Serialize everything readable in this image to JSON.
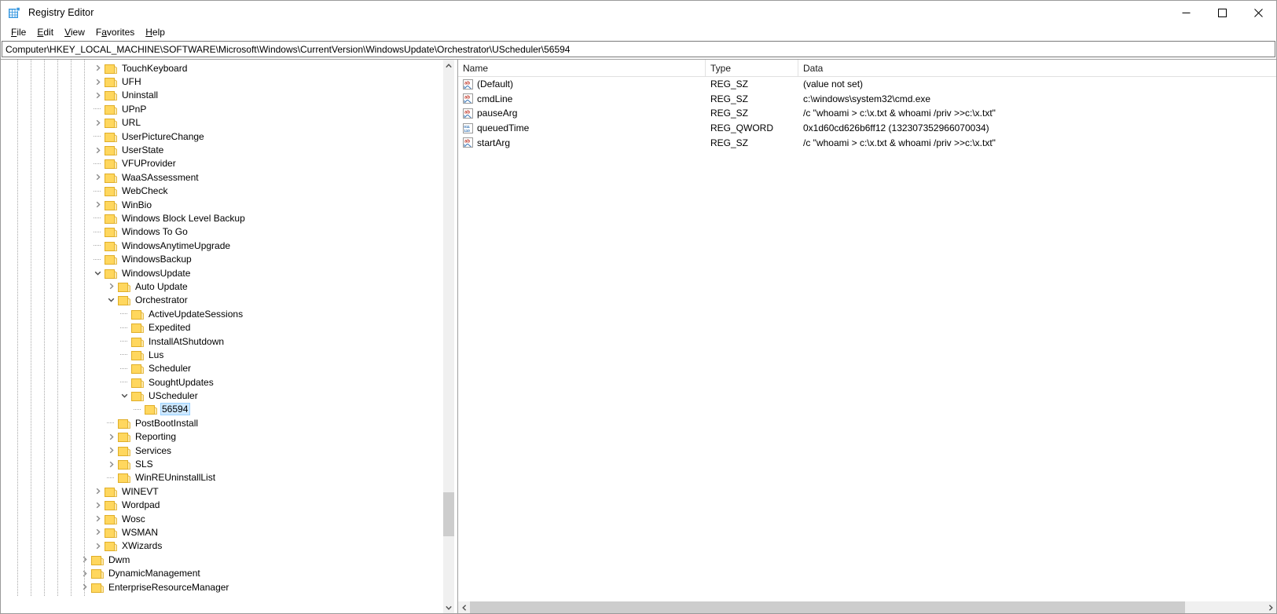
{
  "window": {
    "title": "Registry Editor",
    "icon": "registry-editor-icon",
    "minimize_label": "—",
    "maximize_label": "□",
    "close_label": "×"
  },
  "menubar": {
    "items": [
      {
        "label": "File",
        "accesskey": "F"
      },
      {
        "label": "Edit",
        "accesskey": "E"
      },
      {
        "label": "View",
        "accesskey": "V"
      },
      {
        "label": "Favorites",
        "accesskey": "a"
      },
      {
        "label": "Help",
        "accesskey": "H"
      }
    ]
  },
  "address": {
    "value": "Computer\\HKEY_LOCAL_MACHINE\\SOFTWARE\\Microsoft\\Windows\\CurrentVersion\\WindowsUpdate\\Orchestrator\\UScheduler\\56594",
    "placeholder": "Computer\\"
  },
  "tree": {
    "nodes": [
      {
        "label": "TouchKeyboard",
        "depth": 6,
        "state": "collapsed"
      },
      {
        "label": "UFH",
        "depth": 6,
        "state": "collapsed"
      },
      {
        "label": "Uninstall",
        "depth": 6,
        "state": "collapsed"
      },
      {
        "label": "UPnP",
        "depth": 6,
        "state": "leaf"
      },
      {
        "label": "URL",
        "depth": 6,
        "state": "collapsed"
      },
      {
        "label": "UserPictureChange",
        "depth": 6,
        "state": "leaf"
      },
      {
        "label": "UserState",
        "depth": 6,
        "state": "collapsed"
      },
      {
        "label": "VFUProvider",
        "depth": 6,
        "state": "leaf"
      },
      {
        "label": "WaaSAssessment",
        "depth": 6,
        "state": "collapsed"
      },
      {
        "label": "WebCheck",
        "depth": 6,
        "state": "leaf"
      },
      {
        "label": "WinBio",
        "depth": 6,
        "state": "collapsed"
      },
      {
        "label": "Windows Block Level Backup",
        "depth": 6,
        "state": "leaf"
      },
      {
        "label": "Windows To Go",
        "depth": 6,
        "state": "leaf"
      },
      {
        "label": "WindowsAnytimeUpgrade",
        "depth": 6,
        "state": "leaf"
      },
      {
        "label": "WindowsBackup",
        "depth": 6,
        "state": "leaf"
      },
      {
        "label": "WindowsUpdate",
        "depth": 6,
        "state": "expanded"
      },
      {
        "label": "Auto Update",
        "depth": 7,
        "state": "collapsed"
      },
      {
        "label": "Orchestrator",
        "depth": 7,
        "state": "expanded"
      },
      {
        "label": "ActiveUpdateSessions",
        "depth": 8,
        "state": "leaf"
      },
      {
        "label": "Expedited",
        "depth": 8,
        "state": "leaf"
      },
      {
        "label": "InstallAtShutdown",
        "depth": 8,
        "state": "leaf"
      },
      {
        "label": "Lus",
        "depth": 8,
        "state": "leaf"
      },
      {
        "label": "Scheduler",
        "depth": 8,
        "state": "leaf"
      },
      {
        "label": "SoughtUpdates",
        "depth": 8,
        "state": "leaf"
      },
      {
        "label": "UScheduler",
        "depth": 8,
        "state": "expanded"
      },
      {
        "label": "56594",
        "depth": 9,
        "state": "leaf",
        "selected": true
      },
      {
        "label": "PostBootInstall",
        "depth": 7,
        "state": "leaf"
      },
      {
        "label": "Reporting",
        "depth": 7,
        "state": "collapsed"
      },
      {
        "label": "Services",
        "depth": 7,
        "state": "collapsed"
      },
      {
        "label": "SLS",
        "depth": 7,
        "state": "collapsed"
      },
      {
        "label": "WinREUninstallList",
        "depth": 7,
        "state": "leaf"
      },
      {
        "label": "WINEVT",
        "depth": 6,
        "state": "collapsed"
      },
      {
        "label": "Wordpad",
        "depth": 6,
        "state": "collapsed"
      },
      {
        "label": "Wosc",
        "depth": 6,
        "state": "collapsed"
      },
      {
        "label": "WSMAN",
        "depth": 6,
        "state": "collapsed"
      },
      {
        "label": "XWizards",
        "depth": 6,
        "state": "collapsed"
      },
      {
        "label": "Dwm",
        "depth": 5,
        "state": "collapsed"
      },
      {
        "label": "DynamicManagement",
        "depth": 5,
        "state": "collapsed"
      },
      {
        "label": "EnterpriseResourceManager",
        "depth": 5,
        "state": "collapsed"
      }
    ]
  },
  "values": {
    "columns": [
      "Name",
      "Type",
      "Data"
    ],
    "rows": [
      {
        "icon": "string-value-icon",
        "name": "(Default)",
        "type": "REG_SZ",
        "data": "(value not set)"
      },
      {
        "icon": "string-value-icon",
        "name": "cmdLine",
        "type": "REG_SZ",
        "data": "c:\\windows\\system32\\cmd.exe"
      },
      {
        "icon": "string-value-icon",
        "name": "pauseArg",
        "type": "REG_SZ",
        "data": "/c \"whoami > c:\\x.txt & whoami /priv >>c:\\x.txt\""
      },
      {
        "icon": "binary-value-icon",
        "name": "queuedTime",
        "type": "REG_QWORD",
        "data": "0x1d60cd626b6ff12 (132307352966070034)"
      },
      {
        "icon": "string-value-icon",
        "name": "startArg",
        "type": "REG_SZ",
        "data": "/c \"whoami > c:\\x.txt & whoami /priv >>c:\\x.txt\""
      }
    ]
  },
  "scrollbars": {
    "tree_vertical": {
      "thumb_top_pct": 76,
      "thumb_height_pct": 8
    },
    "list_horizontal": {
      "thumb_left_pct": 0,
      "thumb_width_pct": 90
    },
    "up_arrow": "chevron-up-icon",
    "down_arrow": "chevron-down-icon",
    "left_arrow": "chevron-left-icon",
    "right_arrow": "chevron-right-icon"
  },
  "colors": {
    "folder": "#ffd75e",
    "folder_light": "#fde9a9",
    "selection": "#cde8ff",
    "scrollbar_thumb": "#cdcdcd",
    "scrollbar_track": "#f0f0f0",
    "accent_red": "#c0392b",
    "accent_blue": "#2b6cb0"
  }
}
